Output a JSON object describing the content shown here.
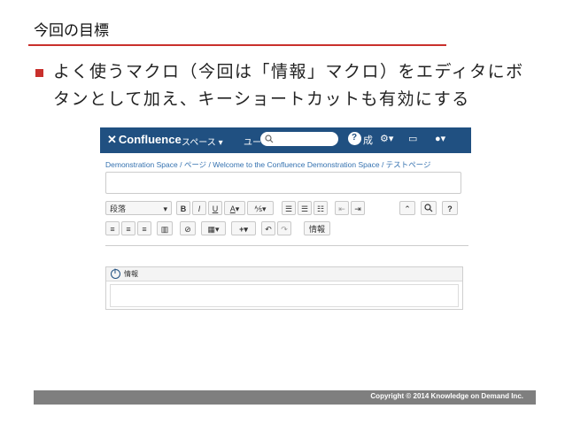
{
  "slide": {
    "title": "今回の目標",
    "bullet": "よく使うマクロ（今回は「情報」マクロ）をエディタにボタンとして加え、キーショートカットも有効にする",
    "footer": "Copyright © 2014 Knowledge on Demand Inc."
  },
  "confluence": {
    "logo": "Confluence",
    "nav": [
      "スペース ▾",
      "ユー"
    ],
    "status_icon_label": "成",
    "breadcrumb": "Demonstration Space / ページ / Welcome to the Confluence Demonstration Space / テストページ",
    "title_input_value": "",
    "toolbar": {
      "paragraph_select": "段落",
      "bold": "B",
      "italic": "I",
      "underline": "U",
      "text_color": "A",
      "more_format": "⅍",
      "info_macro_button": "情報"
    },
    "macro": {
      "label": "情報",
      "body": ""
    }
  },
  "colors": {
    "accent": "#c9302c",
    "confluence_header": "#205081",
    "link": "#3572b0",
    "footer": "#7f7f7f"
  }
}
